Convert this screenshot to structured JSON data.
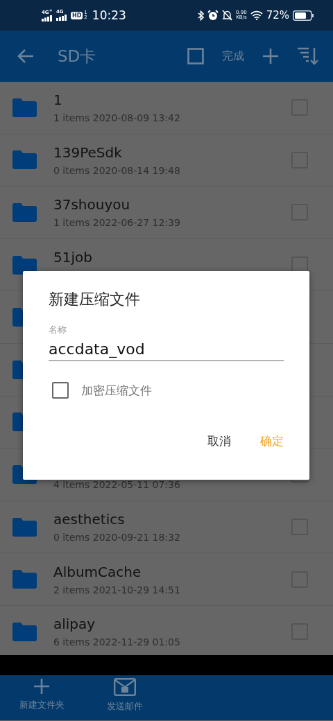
{
  "status_bar": {
    "networks": [
      "4G$^{+}$",
      "4G"
    ],
    "hd_badge": "HD",
    "hd_slots": [
      "1",
      "2"
    ],
    "time": "10:23",
    "speed_value": "0.90",
    "speed_unit": "KB/s",
    "battery": "72%"
  },
  "app_bar": {
    "title": "SD卡",
    "done": "完成"
  },
  "rows": [
    {
      "name": "1",
      "meta": "1 items 2020-08-09 13:42",
      "checked": false
    },
    {
      "name": "139PeSdk",
      "meta": "0 items 2020-08-14 19:48",
      "checked": false
    },
    {
      "name": "37shouyou",
      "meta": "1 items 2022-06-27 12:39",
      "checked": false
    },
    {
      "name": "51job",
      "checked": false
    },
    {},
    {},
    {},
    {
      "meta": "4 items 2022-05-11 07:36",
      "checked": false
    },
    {
      "name": "aesthetics",
      "meta": "0 items 2020-09-21 18:32",
      "checked": false
    },
    {
      "name": "AlbumCache",
      "meta": "2 items 2021-10-29 14:51",
      "checked": false
    },
    {
      "name": "alipay",
      "meta": "6 items 2022-11-29 01:05",
      "checked": false
    }
  ],
  "bottom_nav": [
    {
      "kind": "plus",
      "label": "新建文件夹"
    },
    {
      "kind": "mail",
      "label": "发送邮件"
    }
  ],
  "dialog": {
    "title": "新建压缩文件",
    "field_label": "名称",
    "field_value": "accdata_vod",
    "encrypt": {
      "label": "加密压缩文件",
      "checked": false
    },
    "cancel": "取消",
    "ok": "确定"
  }
}
